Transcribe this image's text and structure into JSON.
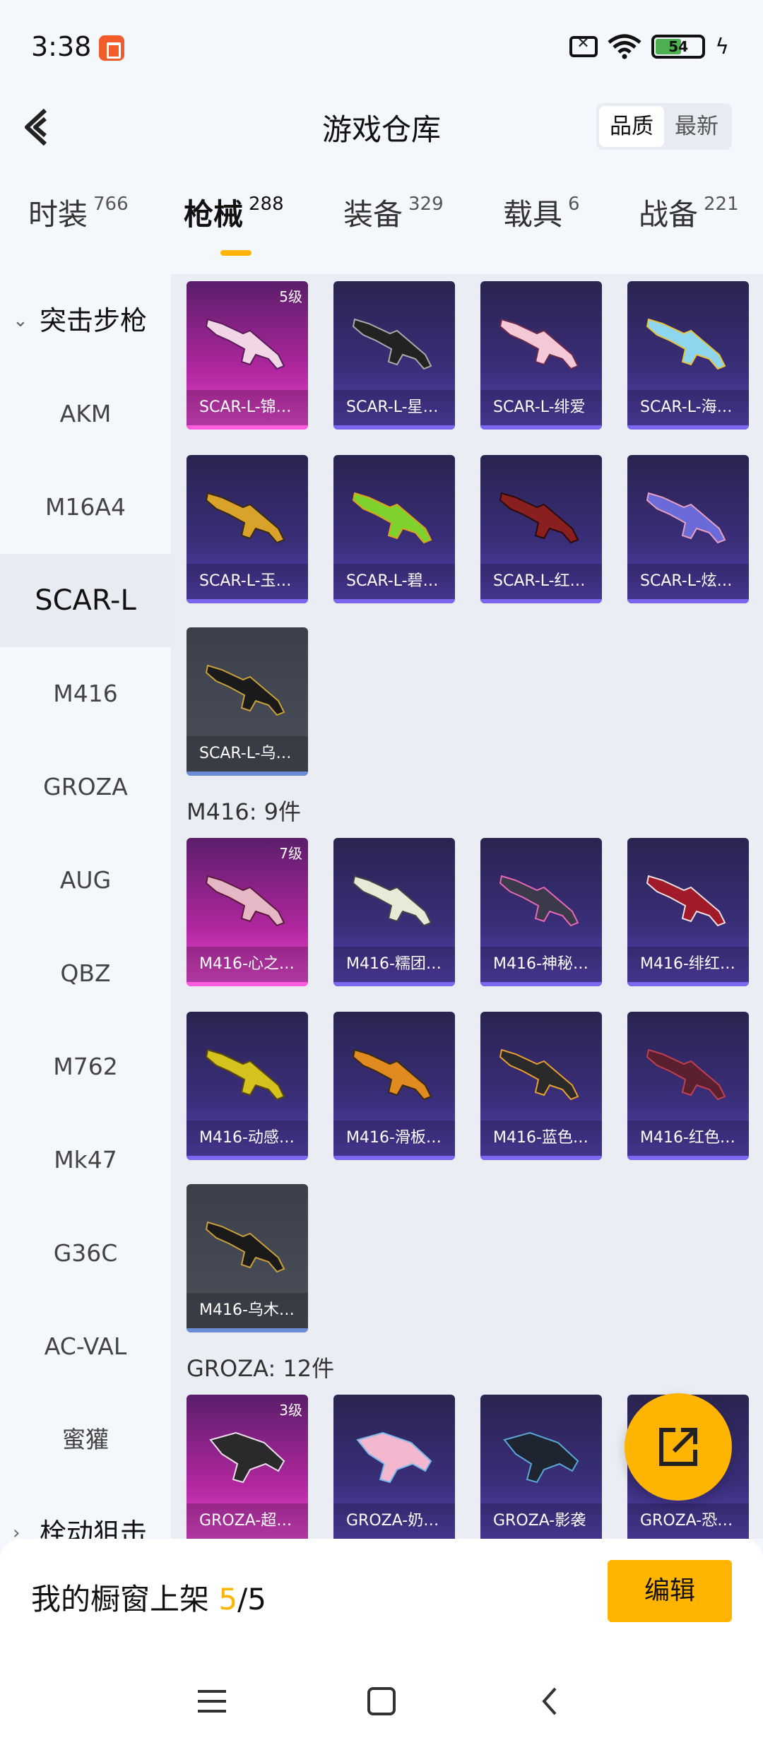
{
  "status_bar": {
    "time": "3:38",
    "battery": "54"
  },
  "header": {
    "title": "游戏仓库",
    "sort_options": [
      "品质",
      "最新"
    ],
    "sort_active": "品质"
  },
  "tabs": [
    {
      "label": "时装",
      "count": "766"
    },
    {
      "label": "枪械",
      "count": "288"
    },
    {
      "label": "装备",
      "count": "329"
    },
    {
      "label": "载具",
      "count": "6"
    },
    {
      "label": "战备",
      "count": "221"
    }
  ],
  "sidebar": {
    "group_top": "突击步枪",
    "items": [
      "AKM",
      "M16A4",
      "SCAR-L",
      "M416",
      "GROZA",
      "AUG",
      "QBZ",
      "M762",
      "Mk47",
      "G36C",
      "AC-VAL",
      "蜜獾"
    ],
    "active": "SCAR-L",
    "group_bottom": "栓动狙击"
  },
  "sections": [
    {
      "title": "",
      "cards": [
        {
          "label": "SCAR-L-锦…",
          "rarity": "pink",
          "level": "5级"
        },
        {
          "label": "SCAR-L-星…",
          "rarity": "purple"
        },
        {
          "label": "SCAR-L-绯爱",
          "rarity": "purple"
        },
        {
          "label": "SCAR-L-海…",
          "rarity": "purple"
        },
        {
          "label": "SCAR-L-玉…",
          "rarity": "purple"
        },
        {
          "label": "SCAR-L-碧…",
          "rarity": "purple"
        },
        {
          "label": "SCAR-L-红…",
          "rarity": "purple"
        },
        {
          "label": "SCAR-L-炫…",
          "rarity": "purple"
        },
        {
          "label": "SCAR-L-乌…",
          "rarity": "gray"
        }
      ]
    },
    {
      "title": "M416: 9件",
      "cards": [
        {
          "label": "M416-心之…",
          "rarity": "pink",
          "level": "7级"
        },
        {
          "label": "M416-糯团…",
          "rarity": "purple"
        },
        {
          "label": "M416-神秘…",
          "rarity": "purple"
        },
        {
          "label": "M416-绯红…",
          "rarity": "purple"
        },
        {
          "label": "M416-动感…",
          "rarity": "purple"
        },
        {
          "label": "M416-滑板…",
          "rarity": "purple"
        },
        {
          "label": "M416-蓝色…",
          "rarity": "purple"
        },
        {
          "label": "M416-红色…",
          "rarity": "purple"
        },
        {
          "label": "M416-乌木…",
          "rarity": "gray"
        }
      ]
    },
    {
      "title": "GROZA: 12件",
      "cards": [
        {
          "label": "GROZA-超…",
          "rarity": "pink",
          "level": "3级"
        },
        {
          "label": "GROZA-奶…",
          "rarity": "purple"
        },
        {
          "label": "GROZA-影袭",
          "rarity": "purple"
        },
        {
          "label": "GROZA-恐…",
          "rarity": "purple"
        }
      ]
    }
  ],
  "bottom": {
    "shelf_label": "我的橱窗上架 ",
    "shelf_count": "5",
    "shelf_total": "/5",
    "edit": "编辑"
  },
  "colors": {
    "accent": "#ffb400",
    "pink": "#e64ad2",
    "purple": "#5a45b8"
  }
}
